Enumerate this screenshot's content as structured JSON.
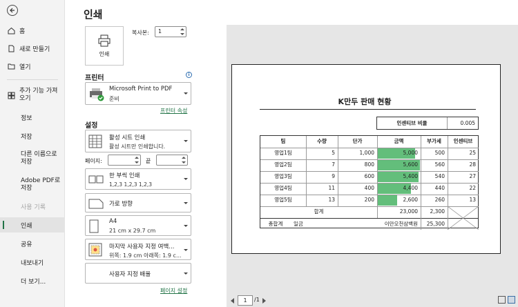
{
  "nav": {
    "items": [
      {
        "label": "홈",
        "icon": "home-icon"
      },
      {
        "label": "새로 만들기",
        "icon": "new-file-icon"
      },
      {
        "label": "열기",
        "icon": "folder-open-icon"
      },
      {
        "label": "추가 기능 가져오기",
        "icon": "addin-icon"
      },
      {
        "label": "정보"
      },
      {
        "label": "저장"
      },
      {
        "label": "다른 이름으로 저장"
      },
      {
        "label": "Adobe PDF로 저장"
      },
      {
        "label": "사용 기록"
      },
      {
        "label": "인쇄"
      },
      {
        "label": "공유"
      },
      {
        "label": "내보내기"
      },
      {
        "label": "더 보기..."
      }
    ],
    "addin_line1": "추가 기능 가져",
    "addin_line2": "오기",
    "saveas_line1": "다른 이름으로",
    "saveas_line2": "저장",
    "pdf_line1": "Adobe PDF로",
    "pdf_line2": "저장",
    "accent": "#217346"
  },
  "settings": {
    "title": "인쇄",
    "print_button": "인쇄",
    "copies_label": "복사본:",
    "copies_value": "1",
    "printer_section": "프린터",
    "printer_name": "Microsoft Print to PDF",
    "printer_status": "준비",
    "printer_props_link": "프린터 속성",
    "settings_section": "설정",
    "scope_title": "활성 시트 인쇄",
    "scope_desc": "활성 시트만 인쇄합니다.",
    "pages_label": "페이지:",
    "pages_to_label": "끝",
    "pages_from": "",
    "pages_to": "",
    "collate_title": "한 부씩 인쇄",
    "collate_desc": "1,2,3     1,2,3     1,2,3",
    "orientation": "가로 방향",
    "paper_title": "A4",
    "paper_size": "21 cm x 29.7 cm",
    "margin_title": "마지막 사용자 지정 여백...",
    "margin_desc": "위쪽: 1.9 cm 아래쪽: 1.9 c...",
    "scaling": "사용자 지정 배율",
    "page_setup_link": "페이지 설정"
  },
  "preview": {
    "sheet_title": "K만두 판매 현황",
    "rate_label": "인센티브 비율",
    "rate_value": "0.005",
    "headers": [
      "팀",
      "수량",
      "단가",
      "금액",
      "부가세",
      "인센티브"
    ],
    "rows": [
      [
        "영업1팀",
        "5",
        "1,000",
        "5,000",
        "500",
        "25"
      ],
      [
        "영업2팀",
        "7",
        "800",
        "5,600",
        "560",
        "28"
      ],
      [
        "영업3팀",
        "9",
        "600",
        "5,400",
        "540",
        "27"
      ],
      [
        "영업4팀",
        "11",
        "400",
        "4,400",
        "440",
        "22"
      ],
      [
        "영업5팀",
        "13",
        "200",
        "2,600",
        "260",
        "13"
      ]
    ],
    "databar_fraction": [
      0.893,
      1.0,
      0.964,
      0.786,
      0.464
    ],
    "databar_color": "#63be7b",
    "sum_label": "합계",
    "sum_amount": "23,000",
    "sum_vat": "2,300",
    "total_label": "총합계",
    "total_unit": "일금",
    "total_words": "이만오천삼백원",
    "total_value": "25,300",
    "page_current": "1",
    "page_total": "/1"
  }
}
